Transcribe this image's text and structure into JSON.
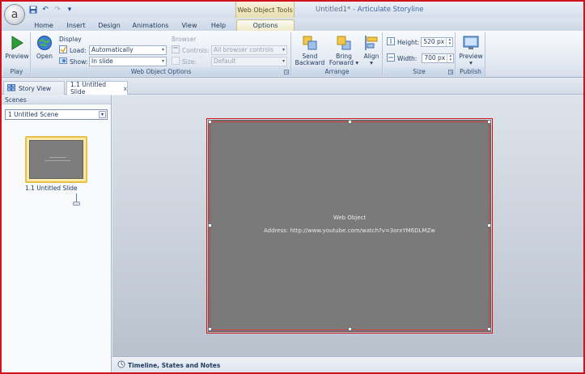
{
  "app": {
    "window_title_doc": "Untitled1* -",
    "window_title_app": "Articulate Storyline",
    "context_tools_label": "Web Object Tools",
    "orb_letter": "a"
  },
  "tabs": [
    "Home",
    "Insert",
    "Design",
    "Animations",
    "View",
    "Help",
    "Options"
  ],
  "ribbon": {
    "play": {
      "preview_label": "Preview",
      "group_label": "Play"
    },
    "web_object_options": {
      "open_label": "Open",
      "display_heading": "Display",
      "load_label": "Load:",
      "load_value": "Automatically",
      "show_label": "Show:",
      "show_value": "In slide",
      "browser_heading": "Browser",
      "controls_label": "Controls:",
      "controls_value": "All browser controls",
      "size_label": "Size:",
      "size_value": "Default",
      "group_label": "Web Object Options"
    },
    "arrange": {
      "send_backward_l1": "Send",
      "send_backward_l2": "Backward",
      "bring_forward_l1": "Bring",
      "bring_forward_l2": "Forward",
      "align_label": "Align",
      "group_label": "Arrange"
    },
    "size": {
      "height_label": "Height:",
      "height_value": "520 px",
      "width_label": "Width:",
      "width_value": "700 px",
      "group_label": "Size"
    },
    "publish": {
      "preview_label": "Preview",
      "group_label": "Publish"
    }
  },
  "doc_tabs": {
    "story_view": "Story View",
    "slide_tab": "1.1 Untitled Slide",
    "close": "x"
  },
  "scenes": {
    "heading": "Scenes",
    "selected_scene": "1 Untitled Scene",
    "slide_label": "1.1 Untitled Slide"
  },
  "slide": {
    "web_object_title": "Web Object",
    "address_text": "Address: http://www.youtube.com/watch?v=3orxYM6DLMZw"
  },
  "timeline": {
    "label": "Timeline, States and Notes"
  },
  "colors": {
    "selection_red": "#d0121b",
    "slide_gray": "#7a7a7a",
    "accent_blue": "#3b66a8"
  }
}
